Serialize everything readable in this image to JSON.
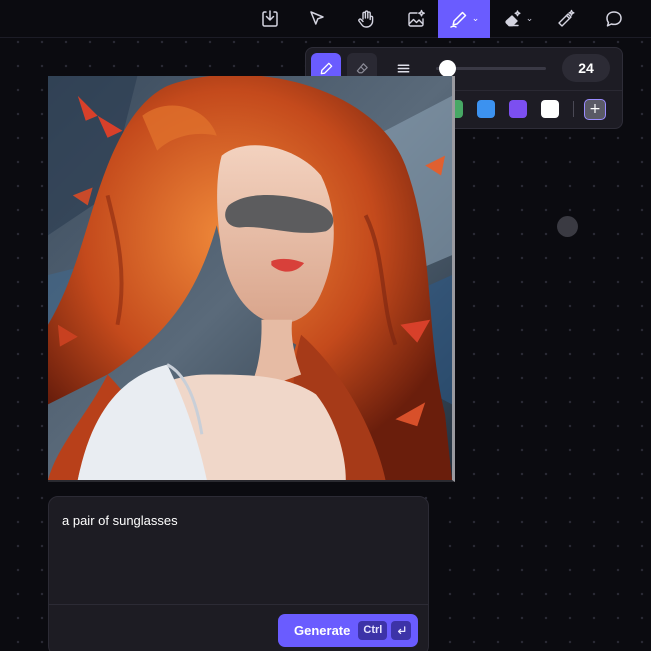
{
  "toolbar": {
    "tools": [
      {
        "id": "import",
        "icon": "import-icon"
      },
      {
        "id": "select",
        "icon": "cursor-icon"
      },
      {
        "id": "pan",
        "icon": "hand-icon"
      },
      {
        "id": "generate-image",
        "icon": "image-sparkle-icon"
      },
      {
        "id": "pen",
        "icon": "pen-icon",
        "active": true,
        "has_dropdown": true
      },
      {
        "id": "magic-eraser",
        "icon": "magic-eraser-icon",
        "has_dropdown": true
      },
      {
        "id": "magic-wand",
        "icon": "magic-wand-icon"
      },
      {
        "id": "comment",
        "icon": "comment-icon"
      }
    ],
    "chevron": "⌄"
  },
  "pen_popover": {
    "brush_size": "24",
    "brush_size_fraction": 0.1,
    "colors": [
      "#000000",
      "#e0512f",
      "#f4a631",
      "#f6cc3c",
      "#47a865",
      "#3c92f0",
      "#7c4ff0",
      "#ffffff"
    ],
    "add_color_glyph": "+"
  },
  "colors": {
    "accent": "#6a5cff",
    "background": "#0b0b10",
    "panel": "#1d1c23"
  },
  "prompt": {
    "text": "a pair of sunglasses",
    "generate_label": "Generate",
    "shortcut_key": "Ctrl",
    "enter_icon": "enter-icon"
  }
}
